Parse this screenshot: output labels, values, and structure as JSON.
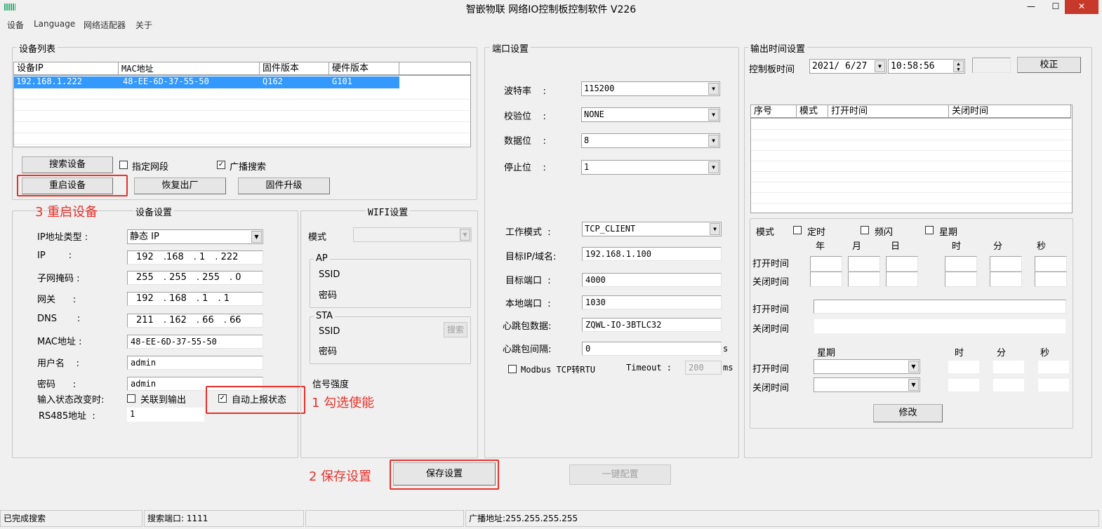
{
  "window": {
    "title": "智嵌物联 网络IO控制板控制软件  V226"
  },
  "menu": [
    "设备",
    "Language",
    "网络适配器",
    "关于"
  ],
  "device_list": {
    "title": "设备列表",
    "columns": [
      "设备IP",
      "MAC地址",
      "固件版本",
      "硬件版本"
    ],
    "rows": [
      [
        "192.168.1.222",
        "48-EE-6D-37-55-50",
        "Q162",
        "G101"
      ]
    ],
    "search_btn": "搜索设备",
    "specify_segment": "指定网段",
    "broadcast_search": "广播搜索",
    "restart_btn": "重启设备",
    "factory_btn": "恢复出厂",
    "upgrade_btn": "固件升级",
    "specify_segment_checked": false,
    "broadcast_checked": true
  },
  "annotations": {
    "a1": "1 勾选使能",
    "a2": "2 保存设置",
    "a3": "3 重启设备"
  },
  "device_settings": {
    "title": "设备设置",
    "ip_type_label": "IP地址类型 :",
    "ip_type": "静态 IP",
    "ip_label": "IP        :",
    "ip": [
      "192",
      ".168",
      ". 1",
      ". 222"
    ],
    "mask_label": "子网掩码 :",
    "mask": [
      "255",
      ". 255",
      ". 255",
      ". 0"
    ],
    "gw_label": "网关      :",
    "gw": [
      "192",
      ". 168",
      ". 1",
      ". 1"
    ],
    "dns_label": "DNS       :",
    "dns": [
      "211",
      ". 162",
      ". 66",
      ". 66"
    ],
    "mac_label": "MAC地址  :",
    "mac": "48-EE-6D-37-55-50",
    "user_label": "用户名    :",
    "user": "admin",
    "pwd_label": "密码      :",
    "pwd": "admin",
    "input_change_label": "输入状态改变时:",
    "link_output": "关联到输出",
    "auto_report": "自动上报状态",
    "auto_report_checked": true,
    "rs485_label": "RS485地址  :",
    "rs485": "1"
  },
  "wifi": {
    "title": "WIFI设置",
    "mode_label": "模式",
    "ap": "AP",
    "sta": "STA",
    "ssid": "SSID",
    "pwd": "密码",
    "search": "搜索",
    "signal": "信号强度"
  },
  "port": {
    "title": "端口设置",
    "baud_label": "波特率    :",
    "baud": "115200",
    "parity_label": "校验位    :",
    "parity": "NONE",
    "data_label": "数据位    :",
    "data": "8",
    "stop_label": "停止位    :",
    "stop": "1",
    "mode_label": "工作模式  :",
    "mode": "TCP_CLIENT",
    "target_ip_label": "目标IP/域名:",
    "target_ip": "192.168.1.100",
    "target_port_label": "目标端口  :",
    "target_port": "4000",
    "local_port_label": "本地端口  :",
    "local_port": "1030",
    "hb_data_label": "心跳包数据:",
    "hb_data": "ZQWL-IO-3BTLC32",
    "hb_interval_label": "心跳包间隔:",
    "hb_interval": "0",
    "unit_s": "s",
    "modbus": "Modbus TCP转RTU",
    "timeout_label": "Timeout :",
    "timeout": "200",
    "unit_ms": "ms"
  },
  "output_time": {
    "title": "输出时间设置",
    "board_time_label": "控制板时间",
    "date": "2021/ 6/27",
    "time": "10:58:56",
    "calibrate": "校正",
    "columns": [
      "序号",
      "模式",
      "打开时间",
      "关闭时间"
    ],
    "mode_label": "模式",
    "m_timer": "定时",
    "m_flash": "频闪",
    "m_week": "星期",
    "ymd": [
      "年",
      "月",
      "日"
    ],
    "hms": [
      "时",
      "分",
      "秒"
    ],
    "open": "打开时间",
    "close": "关闭时间",
    "week": "星期",
    "modify": "修改"
  },
  "save_btn": "保存设置",
  "one_key": "一键配置",
  "status": [
    "已完成搜索",
    "搜索端口: 1111",
    "",
    "广播地址:255.255.255.255"
  ]
}
